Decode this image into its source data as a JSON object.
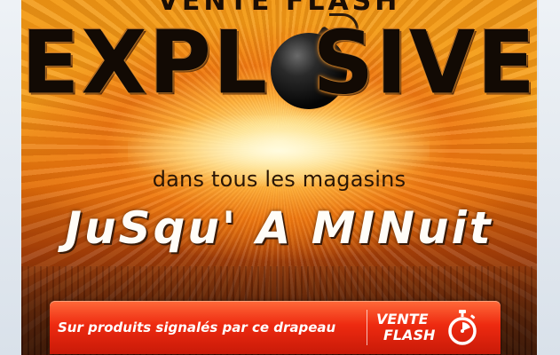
{
  "banner": {
    "top_text": "VENTE FLASH",
    "headline": {
      "left": "EXPL",
      "right": "SIVE"
    },
    "subline": "dans tous les magasins",
    "until": "JuSqu' A MINuit",
    "flash_bar": {
      "text": "Sur produits signalés par ce drapeau",
      "logo_line1": "VENTE",
      "logo_line2": "FLASH"
    },
    "icons": {
      "bomb": "bomb-icon",
      "stopwatch": "stopwatch-icon"
    },
    "colors": {
      "bar_red": "#ee2a10",
      "sky_orange": "#f39a16",
      "headline_dark": "#120a04"
    }
  }
}
